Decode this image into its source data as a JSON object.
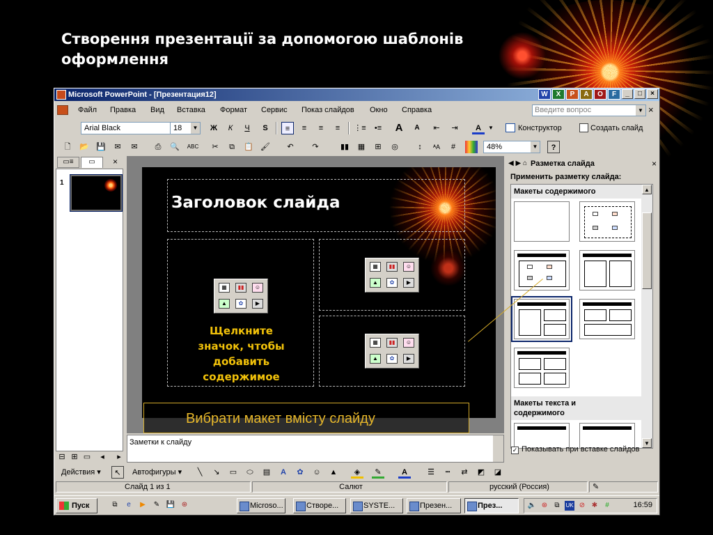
{
  "slide_title": "Створення презентації за допомогою шаблонів оформлення",
  "window": {
    "title": "Microsoft PowerPoint - [Презентация12]",
    "min": "_",
    "max": "□",
    "close": "×"
  },
  "menu": {
    "items": [
      "Файл",
      "Правка",
      "Вид",
      "Вставка",
      "Формат",
      "Сервис",
      "Показ слайдов",
      "Окно",
      "Справка"
    ],
    "help_placeholder": "Введите вопрос",
    "doc_close": "×"
  },
  "format_toolbar": {
    "font_name": "Arial Black",
    "font_size": "18",
    "bold": "Ж",
    "italic": "К",
    "underline": "Ч",
    "shadow": "S",
    "designer": "Конструктор",
    "new_slide": "Создать слайд"
  },
  "standard_toolbar": {
    "zoom": "48%"
  },
  "left_pane": {
    "slide_number": "1"
  },
  "slide": {
    "title_placeholder": "Заголовок слайда",
    "content_hint_lines": [
      "Щелкните",
      "значок, чтобы",
      "добавить",
      "содержимое"
    ]
  },
  "annotation": "Вибрати макет вмісту слайду",
  "notes_placeholder": "Заметки к слайду",
  "task_pane": {
    "title": "Разметка слайда",
    "apply_label": "Применить разметку слайда:",
    "group_content": "Макеты содержимого",
    "group_text_content_lines": [
      "Макеты текста и",
      "содержимого"
    ],
    "show_on_insert": "Показывать при вставке слайдов"
  },
  "draw_toolbar": {
    "actions": "Действия",
    "autoshapes": "Автофигуры"
  },
  "status": {
    "slide": "Слайд 1 из 1",
    "design": "Салют",
    "language": "русский (Россия)"
  },
  "taskbar": {
    "start": "Пуск",
    "tasks": [
      "Microso...",
      "Створе...",
      "SYSTE...",
      "Презен...",
      "През..."
    ],
    "clock": "16:59"
  },
  "colors": {
    "title_bar": "#0a246a",
    "window_face": "#d4d0c8",
    "slide_hint": "#f2c20a",
    "annotation": "#e8b82a"
  }
}
